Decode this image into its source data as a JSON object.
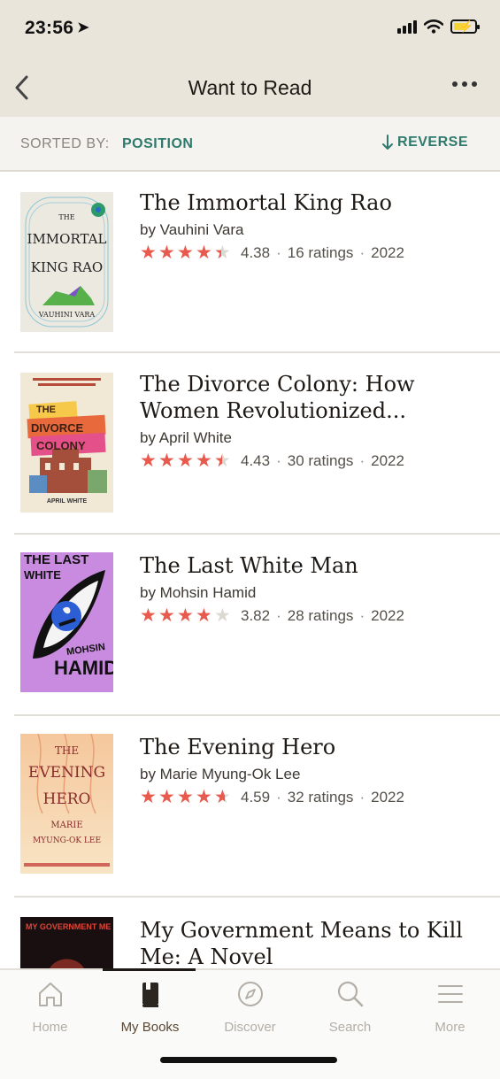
{
  "status_bar": {
    "time": "23:56"
  },
  "header": {
    "title": "Want to Read"
  },
  "sort_bar": {
    "label": "SORTED BY:",
    "value": "POSITION",
    "reverse_label": "REVERSE"
  },
  "books": [
    {
      "title": "The Immortal King Rao",
      "author": "by Vauhini Vara",
      "rating": "4.38",
      "ratings_count": "16 ratings",
      "year": "2022",
      "cover": {
        "line1": "THE",
        "line2": "IMMORTAL",
        "line3": "KING RAO",
        "line4": "VAUHINI VARA",
        "background": "#e8e6dc"
      }
    },
    {
      "title": "The Divorce Colony: How Women Revolutionized...",
      "author": "by April White",
      "rating": "4.43",
      "ratings_count": "30 ratings",
      "year": "2022",
      "cover": {
        "line1": "THE",
        "line2": "DIVORCE",
        "line3": "COLONY",
        "line4": "APRIL WHITE",
        "background": "#f0e6d2"
      }
    },
    {
      "title": "The Last White Man",
      "author": "by Mohsin Hamid",
      "rating": "3.82",
      "ratings_count": "28 ratings",
      "year": "2022",
      "cover": {
        "line1": "THE LAST",
        "line2": "WHITE",
        "line3": "MOHSIN",
        "line4": "HAMID",
        "background": "#c98be0"
      }
    },
    {
      "title": "The Evening Hero",
      "author": "by Marie Myung-Ok Lee",
      "rating": "4.59",
      "ratings_count": "32 ratings",
      "year": "2022",
      "cover": {
        "line1": "THE",
        "line2": "EVENING",
        "line3": "HERO",
        "line4": "MARIE",
        "line5": "MYUNG-OK LEE",
        "background": "#f4d8b8"
      }
    },
    {
      "title": "My Government Means to Kill Me: A Novel",
      "cover": {
        "line1": "MY GOVERNMENT MEANS TO KILL",
        "background": "#1a0f10"
      }
    }
  ],
  "tab_bar": {
    "tabs": [
      {
        "label": "Home",
        "icon": "home-icon"
      },
      {
        "label": "My Books",
        "icon": "book-icon",
        "active": true
      },
      {
        "label": "Discover",
        "icon": "compass-icon"
      },
      {
        "label": "Search",
        "icon": "search-icon"
      },
      {
        "label": "More",
        "icon": "menu-icon"
      }
    ]
  },
  "colors": {
    "header_background": "#e9e5da",
    "accent": "#2f7a6c",
    "star": "#e95a4e",
    "text": "#1e1915"
  }
}
